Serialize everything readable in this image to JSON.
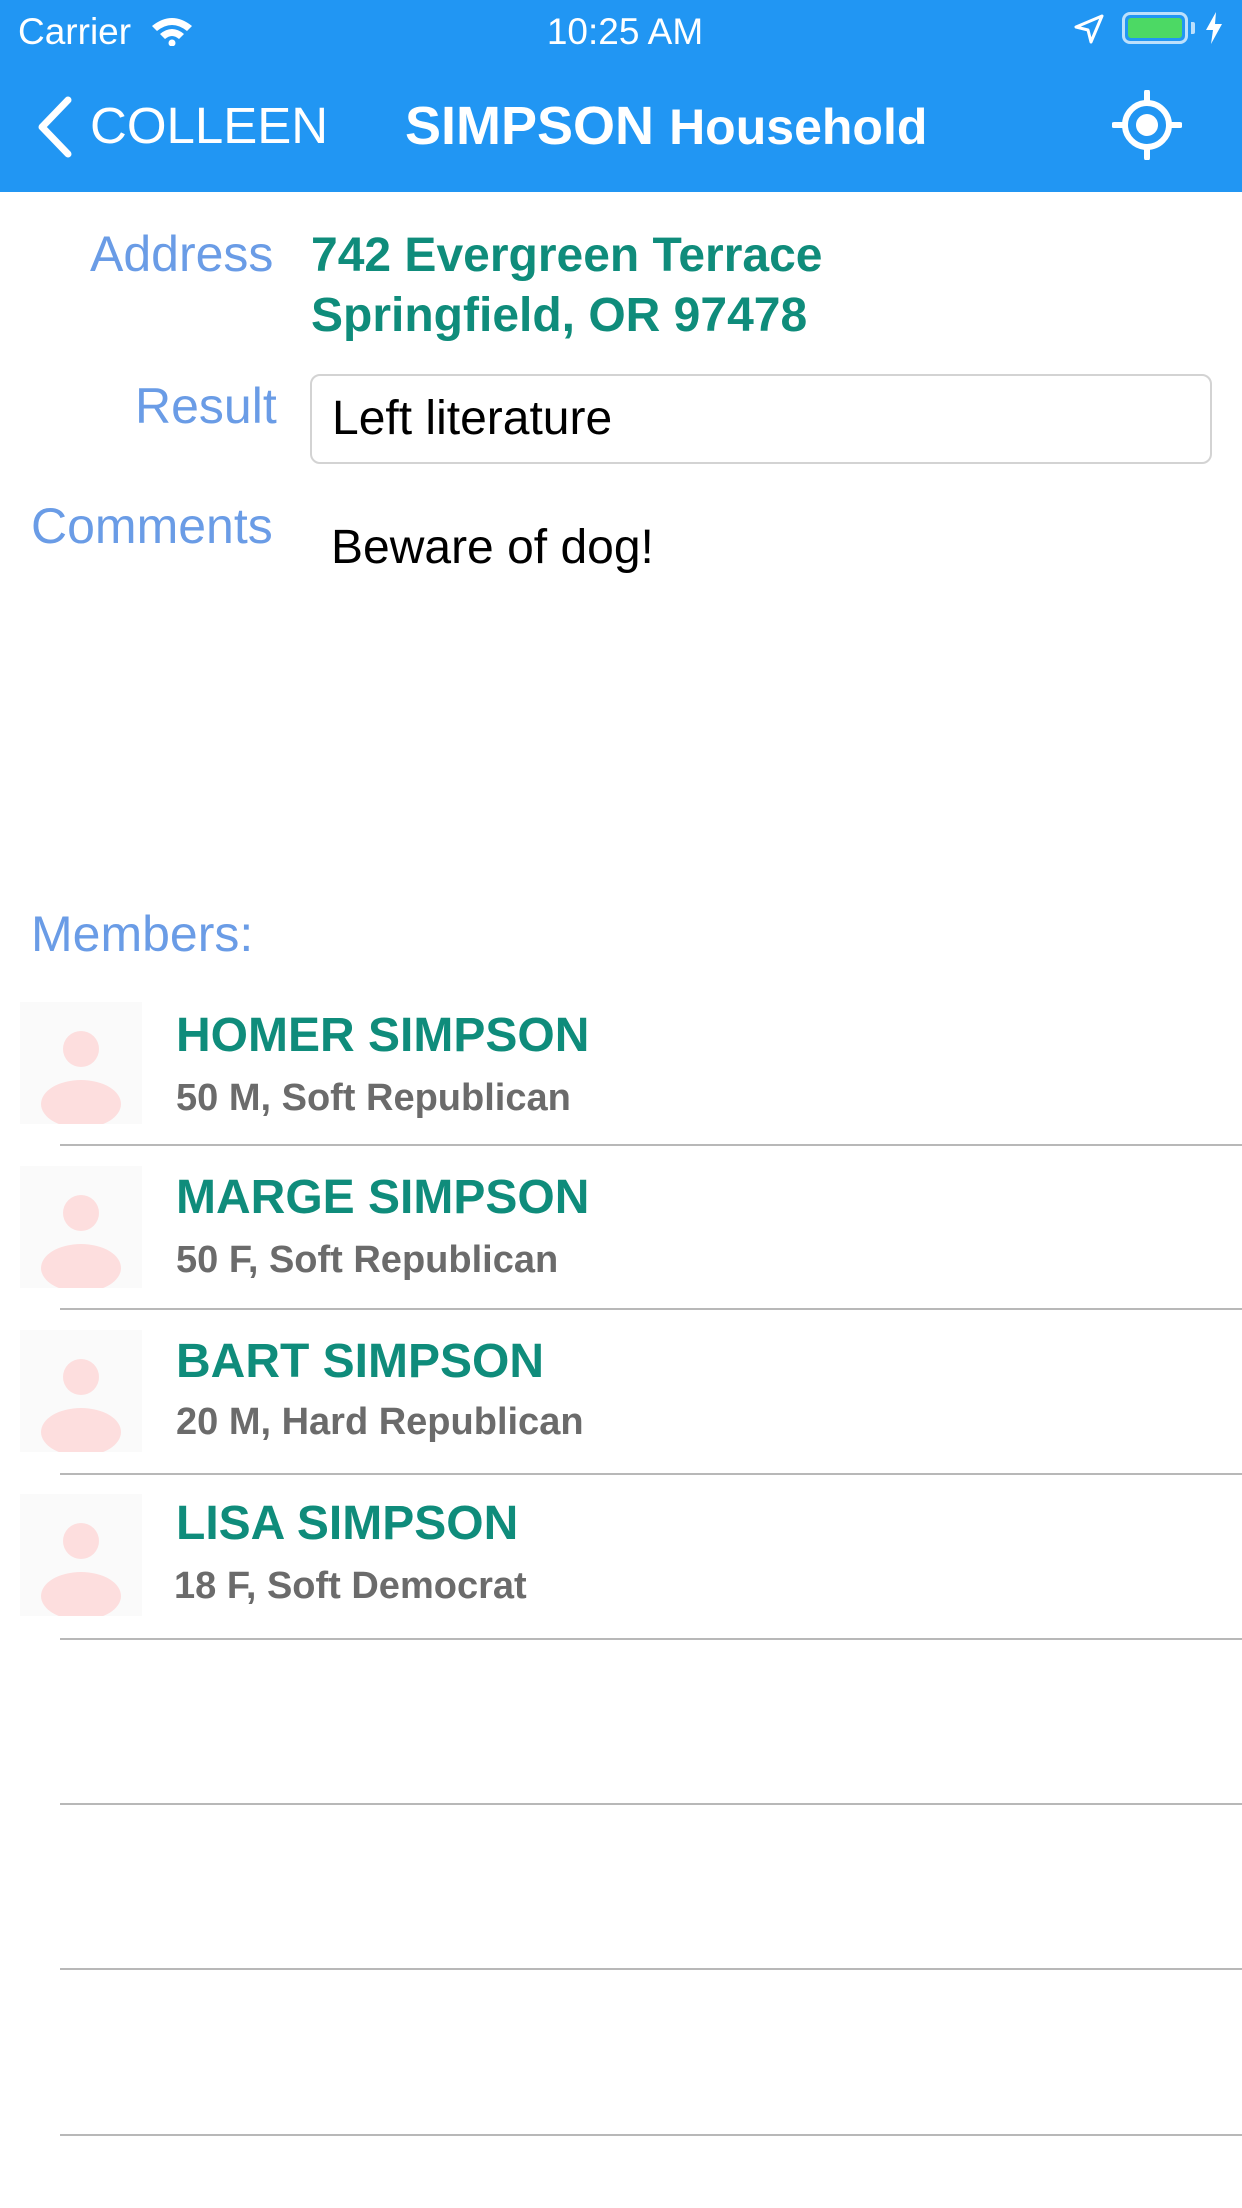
{
  "status_bar": {
    "carrier": "Carrier",
    "time": "10:25 AM",
    "battery_level": 1.0,
    "battery_color": "#4cd964"
  },
  "nav": {
    "back_label": "COLLEEN",
    "title_strong": "SIMPSON",
    "title_rest": "Household",
    "back_icon": "chevron-left-icon",
    "action_icon": "location-target-icon",
    "bar_color": "#2196f3"
  },
  "form": {
    "address_label": "Address",
    "address_line1": "742 Evergreen Terrace",
    "address_line2": "Springfield, OR 97478",
    "result_label": "Result",
    "result_value": "Left literature",
    "comments_label": "Comments",
    "comments_value": "Beware of dog!"
  },
  "members": {
    "heading": "Members:",
    "items": [
      {
        "name": "HOMER SIMPSON",
        "details": "50 M, Soft Republican"
      },
      {
        "name": "MARGE SIMPSON",
        "details": "50 F, Soft Republican"
      },
      {
        "name": "BART SIMPSON",
        "details": "20 M, Hard Republican"
      },
      {
        "name": "LISA SIMPSON",
        "details": "18 F, Soft Democrat"
      }
    ]
  },
  "colors": {
    "label": "#6a9ce6",
    "accent": "#0f8c7b",
    "avatar": "#fddede"
  }
}
